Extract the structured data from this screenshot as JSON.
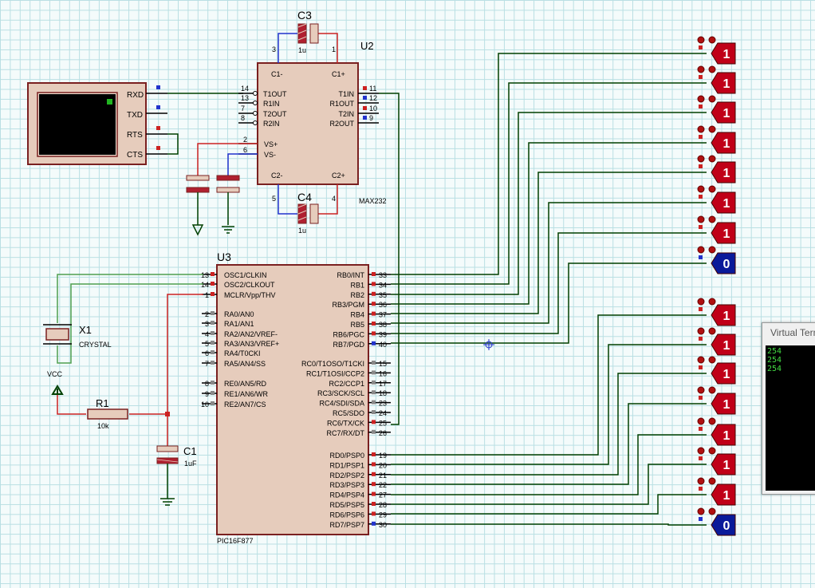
{
  "u2": {
    "ref": "U2",
    "part": "MAX232",
    "pins_left": [
      "T1OUT",
      "R1IN",
      "T2OUT",
      "R2IN"
    ],
    "pins_left_nums": [
      "14",
      "13",
      "7",
      "8"
    ],
    "pins_right": [
      "T1IN",
      "R1OUT",
      "T2IN",
      "R2OUT"
    ],
    "pins_right_nums": [
      "11",
      "12",
      "10",
      "9"
    ],
    "c1m": "C1-",
    "c1p": "C1+",
    "c2m": "C2-",
    "c2p": "C2+",
    "vsp": "VS+",
    "vsm": "VS-",
    "pin_vsp": "2",
    "pin_vsm": "6",
    "pin3": "3",
    "pin1": "1",
    "pin5": "5",
    "pin4": "4"
  },
  "c3": {
    "ref": "C3",
    "value": "1u"
  },
  "c4": {
    "ref": "C4",
    "value": "1u"
  },
  "rs232": {
    "labels": [
      "RXD",
      "TXD",
      "RTS",
      "CTS"
    ]
  },
  "u3": {
    "ref": "U3",
    "part": "PIC16F877",
    "left_pins": [
      {
        "num": "13",
        "name": "OSC1/CLKIN"
      },
      {
        "num": "14",
        "name": "OSC2/CLKOUT"
      },
      {
        "num": "1",
        "name": "MCLR/Vpp/THV"
      },
      {
        "num": "2",
        "name": "RA0/AN0"
      },
      {
        "num": "3",
        "name": "RA1/AN1"
      },
      {
        "num": "4",
        "name": "RA2/AN2/VREF-"
      },
      {
        "num": "5",
        "name": "RA3/AN3/VREF+"
      },
      {
        "num": "6",
        "name": "RA4/T0CKI"
      },
      {
        "num": "7",
        "name": "RA5/AN4/SS"
      },
      {
        "num": "8",
        "name": "RE0/AN5/RD"
      },
      {
        "num": "9",
        "name": "RE1/AN6/WR"
      },
      {
        "num": "10",
        "name": "RE2/AN7/CS"
      }
    ],
    "right_pins": [
      {
        "num": "33",
        "name": "RB0/INT"
      },
      {
        "num": "34",
        "name": "RB1"
      },
      {
        "num": "35",
        "name": "RB2"
      },
      {
        "num": "36",
        "name": "RB3/PGM"
      },
      {
        "num": "37",
        "name": "RB4"
      },
      {
        "num": "38",
        "name": "RB5"
      },
      {
        "num": "39",
        "name": "RB6/PGC"
      },
      {
        "num": "40",
        "name": "RB7/PGD"
      },
      {
        "num": "15",
        "name": "RC0/T1OSO/T1CKI"
      },
      {
        "num": "16",
        "name": "RC1/T1OSI/CCP2"
      },
      {
        "num": "17",
        "name": "RC2/CCP1"
      },
      {
        "num": "18",
        "name": "RC3/SCK/SCL"
      },
      {
        "num": "23",
        "name": "RC4/SDI/SDA"
      },
      {
        "num": "24",
        "name": "RC5/SDO"
      },
      {
        "num": "25",
        "name": "RC6/TX/CK"
      },
      {
        "num": "26",
        "name": "RC7/RX/DT"
      },
      {
        "num": "19",
        "name": "RD0/PSP0"
      },
      {
        "num": "20",
        "name": "RD1/PSP1"
      },
      {
        "num": "21",
        "name": "RD2/PSP2"
      },
      {
        "num": "22",
        "name": "RD3/PSP3"
      },
      {
        "num": "27",
        "name": "RD4/PSP4"
      },
      {
        "num": "28",
        "name": "RD5/PSP5"
      },
      {
        "num": "29",
        "name": "RD6/PSP6"
      },
      {
        "num": "30",
        "name": "RD7/PSP7"
      }
    ]
  },
  "x1": {
    "ref": "X1",
    "value": "CRYSTAL"
  },
  "r1": {
    "ref": "R1",
    "value": "10k"
  },
  "c1": {
    "ref": "C1",
    "value": "1uF"
  },
  "vcc": {
    "label": "VCC"
  },
  "probes_b": [
    "1",
    "1",
    "1",
    "1",
    "1",
    "1",
    "1",
    "0"
  ],
  "probes_d": [
    "1",
    "1",
    "1",
    "1",
    "1",
    "1",
    "1",
    "0"
  ],
  "terminal": {
    "title": "Virtual Terminal",
    "lines": [
      "254",
      "254",
      "254"
    ]
  },
  "colors": {
    "wire": "#004000",
    "power_wire": "#d03020",
    "blue_wire": "#2233cc",
    "chip_fill": "#e6ccbc",
    "chip_border": "#7a2020",
    "probe_high": "#c00018",
    "probe_low": "#0a1a9a"
  }
}
